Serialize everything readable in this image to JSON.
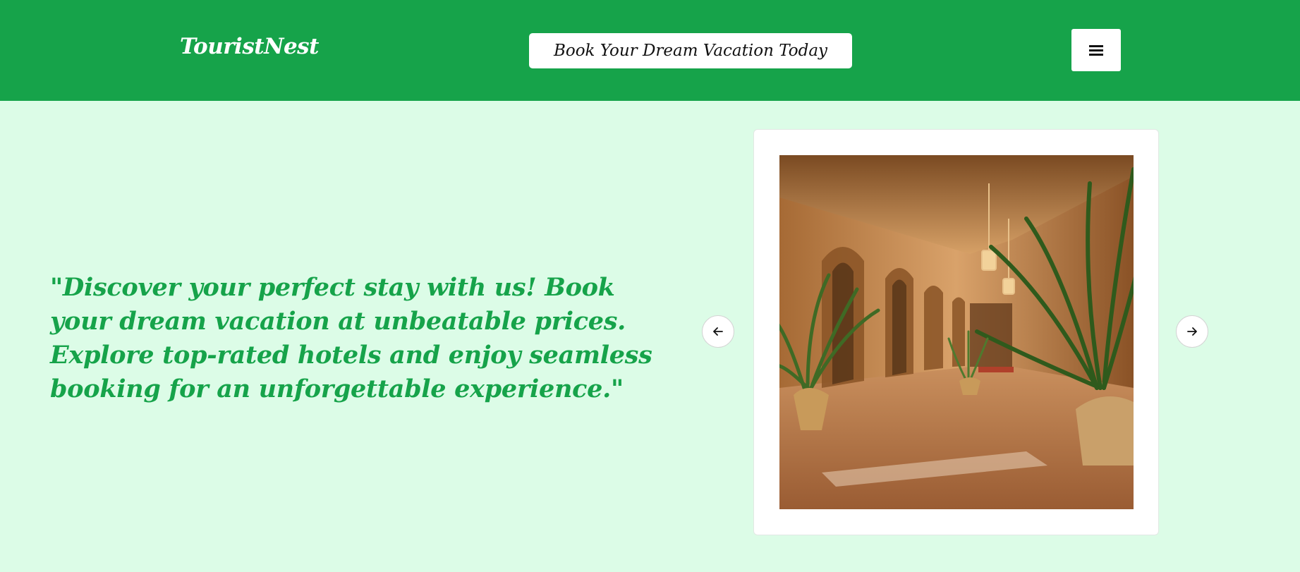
{
  "header": {
    "brand": "TouristNest",
    "cta_label": "Book Your Dream Vacation Today",
    "menu_icon": "hamburger-menu-icon"
  },
  "hero": {
    "quote": "\"Discover your perfect stay with us! Book your dream vacation at unbeatable prices. Explore top-rated hotels and enjoy seamless booking for an unforgettable experience.\""
  },
  "carousel": {
    "prev_icon": "arrow-left-icon",
    "next_icon": "arrow-right-icon",
    "image_subject": "hotel-lobby-photo"
  },
  "colors": {
    "header_bg": "#16a34a",
    "page_bg": "#dcfce7",
    "accent_text": "#16a34a",
    "card_bg": "#ffffff"
  }
}
